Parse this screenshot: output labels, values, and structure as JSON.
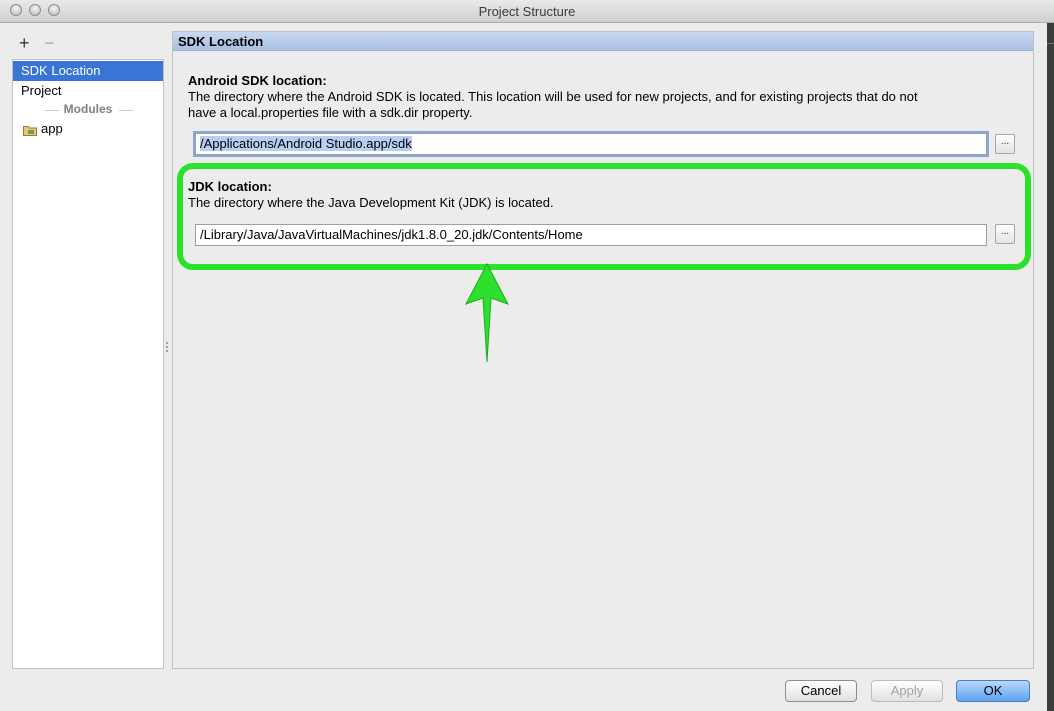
{
  "window": {
    "title": "Project Structure"
  },
  "toolbar": {
    "add": "+",
    "remove": "−"
  },
  "sidebar": {
    "items": [
      {
        "label": "SDK Location",
        "selected": true
      },
      {
        "label": "Project",
        "selected": false
      }
    ],
    "modules_header": "Modules",
    "modules": [
      {
        "label": "app",
        "icon": "module-folder-icon"
      }
    ]
  },
  "panel": {
    "header": "SDK Location",
    "android_sdk": {
      "title": "Android SDK location:",
      "description_line1": "The directory where the Android SDK is located. This location will be used for new projects, and for existing projects that do not",
      "description_line2": "have a local.properties file with a sdk.dir property.",
      "path": "/Applications/Android Studio.app/sdk",
      "browse": "..."
    },
    "jdk": {
      "title": "JDK location:",
      "description": "The directory where the Java Development Kit (JDK) is located.",
      "path": "/Library/Java/JavaVirtualMachines/jdk1.8.0_20.jdk/Contents/Home",
      "browse": "..."
    }
  },
  "annotation": {
    "color": "#2ee02e"
  },
  "buttons": {
    "cancel": "Cancel",
    "apply": "Apply",
    "ok": "OK"
  },
  "colors": {
    "selection": "#3875d7",
    "header": "#b5c9ea",
    "primary_button": "#5fa2ef"
  }
}
